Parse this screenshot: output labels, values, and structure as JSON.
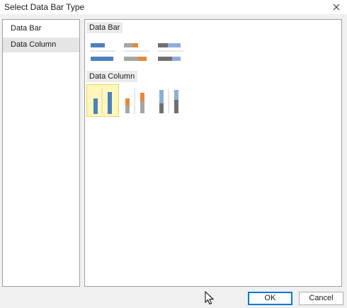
{
  "window": {
    "title": "Select Data Bar Type",
    "close_icon": "close-icon"
  },
  "type_list": {
    "items": [
      {
        "label": "Data Bar",
        "selected": false
      },
      {
        "label": "Data Column",
        "selected": true
      }
    ]
  },
  "gallery": {
    "data_bar_section": {
      "label": "Data Bar",
      "options": [
        "data-bar-single",
        "data-bar-stacked-orange",
        "data-bar-stacked-blue"
      ]
    },
    "data_column_section": {
      "label": "Data Column",
      "options": [
        "data-column-single",
        "data-column-stacked-orange",
        "data-column-stacked-blue"
      ],
      "selected_index": 0
    }
  },
  "colors": {
    "blue": "#4e7fbe",
    "light_blue": "#8eaed6",
    "orange": "#e08a3c",
    "gray": "#a6a6a6",
    "dark_gray": "#707070",
    "selected_fill": "#fff7ba"
  },
  "buttons": {
    "ok_label": "OK",
    "cancel_label": "Cancel"
  }
}
